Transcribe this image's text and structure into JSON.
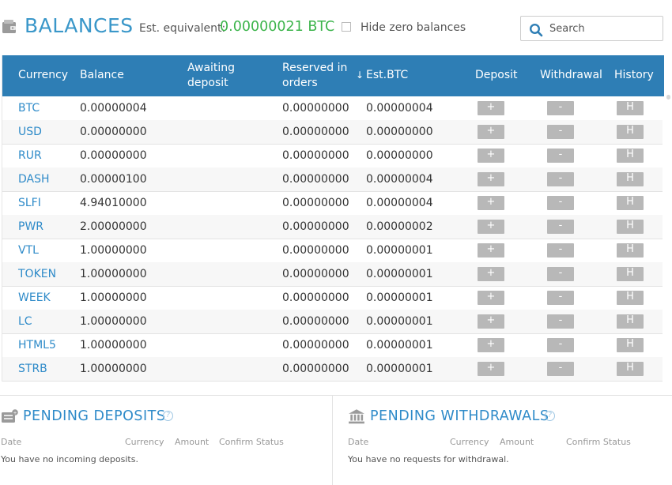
{
  "header": {
    "title": "BALANCES",
    "est_label": "Est. equivalent:",
    "est_value": "0.00000021 BTC",
    "hide_zero_label": "Hide zero balances",
    "hide_zero_checked": false,
    "search_placeholder": "Search"
  },
  "table": {
    "columns": {
      "currency": "Currency",
      "balance": "Balance",
      "awaiting_1": "Awaiting",
      "awaiting_2": "deposit",
      "reserved_1": "Reserved in",
      "reserved_2": "orders",
      "sort_arrow": "↓",
      "est_btc": "Est.BTC",
      "deposit": "Deposit",
      "withdrawal": "Withdrawal",
      "history": "History"
    },
    "buttons": {
      "deposit": "+",
      "withdraw": "-",
      "history": "H"
    },
    "rows": [
      {
        "currency": "BTC",
        "balance": "0.00000004",
        "reserved": "0.00000000",
        "est_btc": "0.00000004"
      },
      {
        "currency": "USD",
        "balance": "0.00000000",
        "reserved": "0.00000000",
        "est_btc": "0.00000000"
      },
      {
        "currency": "RUR",
        "balance": "0.00000000",
        "reserved": "0.00000000",
        "est_btc": "0.00000000"
      },
      {
        "currency": "DASH",
        "balance": "0.00000100",
        "reserved": "0.00000000",
        "est_btc": "0.00000004"
      },
      {
        "currency": "SLFI",
        "balance": "4.94010000",
        "reserved": "0.00000000",
        "est_btc": "0.00000004"
      },
      {
        "currency": "PWR",
        "balance": "2.00000000",
        "reserved": "0.00000000",
        "est_btc": "0.00000002"
      },
      {
        "currency": "VTL",
        "balance": "1.00000000",
        "reserved": "0.00000000",
        "est_btc": "0.00000001"
      },
      {
        "currency": "TOKEN",
        "balance": "1.00000000",
        "reserved": "0.00000000",
        "est_btc": "0.00000001"
      },
      {
        "currency": "WEEK",
        "balance": "1.00000000",
        "reserved": "0.00000000",
        "est_btc": "0.00000001"
      },
      {
        "currency": "LC",
        "balance": "1.00000000",
        "reserved": "0.00000000",
        "est_btc": "0.00000001"
      },
      {
        "currency": "HTML5",
        "balance": "1.00000000",
        "reserved": "0.00000000",
        "est_btc": "0.00000001"
      },
      {
        "currency": "STRB",
        "balance": "1.00000000",
        "reserved": "0.00000000",
        "est_btc": "0.00000001"
      }
    ]
  },
  "pending_deposits": {
    "title": "PENDING DEPOSITS",
    "columns": {
      "date": "Date",
      "currency": "Currency",
      "amount": "Amount",
      "confirm": "Confirm Status"
    },
    "empty": "You have no incoming deposits."
  },
  "pending_withdrawals": {
    "title": "PENDING WITHDRAWALS",
    "columns": {
      "date": "Date",
      "currency": "Currency",
      "amount": "Amount",
      "confirm": "Confirm Status"
    },
    "empty": "You have no requests for withdrawal."
  },
  "colors": {
    "accent": "#2e7eb5",
    "link": "#2f8bc9",
    "positive": "#3cb44b",
    "button": "#b8b8b8"
  },
  "icons": {
    "wallet": "wallet-icon",
    "search": "search-icon",
    "deposit_panel": "inbox-icon",
    "withdraw_panel": "bank-icon",
    "help": "help-icon"
  }
}
